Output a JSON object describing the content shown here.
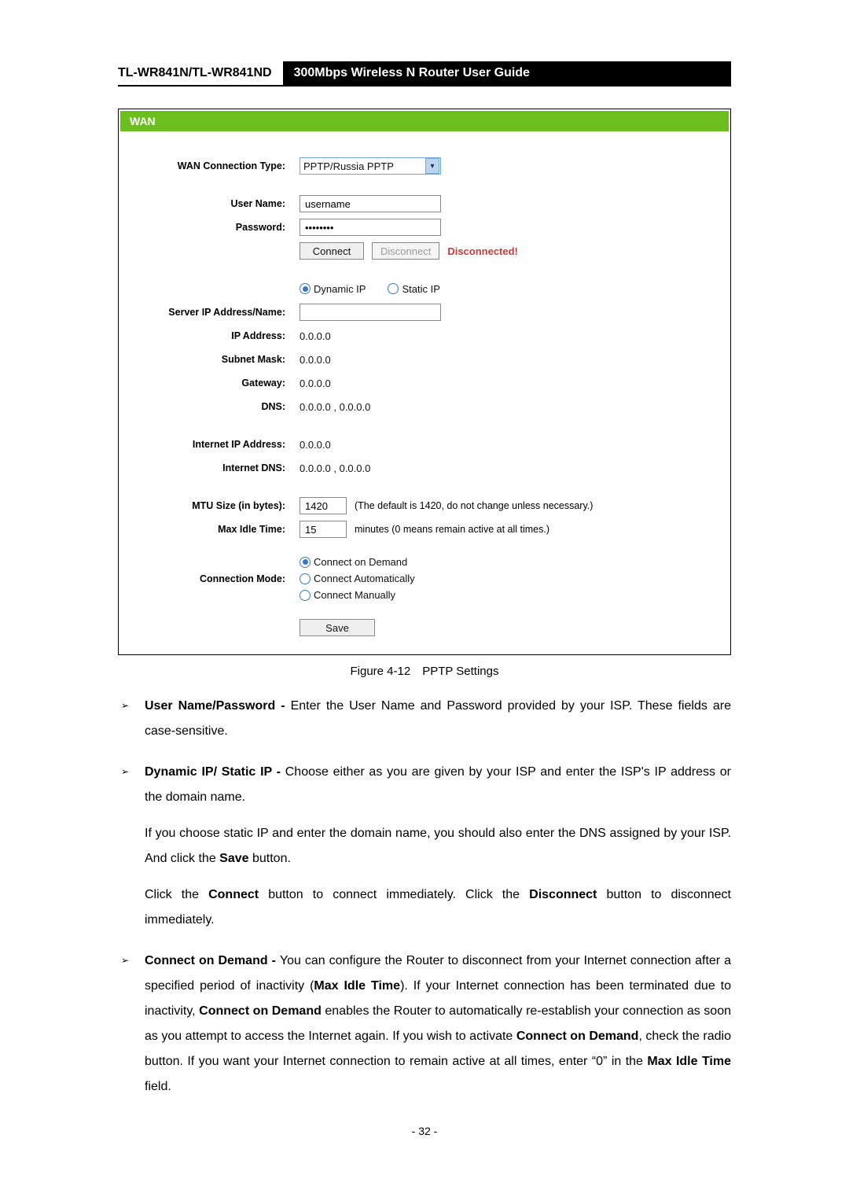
{
  "header": {
    "left": "TL-WR841N/TL-WR841ND",
    "right": "300Mbps Wireless N Router User Guide"
  },
  "panel": {
    "title": "WAN",
    "labels": {
      "wan_conn_type": "WAN Connection Type:",
      "user_name": "User Name:",
      "password": "Password:",
      "server_ip": "Server IP Address/Name:",
      "ip_addr": "IP Address:",
      "subnet": "Subnet Mask:",
      "gateway": "Gateway:",
      "dns": "DNS:",
      "internet_ip": "Internet IP Address:",
      "internet_dns": "Internet DNS:",
      "mtu": "MTU Size (in bytes):",
      "max_idle": "Max Idle Time:",
      "conn_mode": "Connection Mode:"
    },
    "values": {
      "wan_conn_type": "PPTP/Russia PPTP",
      "user_name": "username",
      "password": "••••••••",
      "server_ip": "",
      "ip_addr": "0.0.0.0",
      "subnet": "0.0.0.0",
      "gateway": "0.0.0.0",
      "dns": "0.0.0.0 , 0.0.0.0",
      "internet_ip": "0.0.0.0",
      "internet_dns": "0.0.0.0 , 0.0.0.0",
      "mtu": "1420",
      "max_idle": "15"
    },
    "hints": {
      "mtu": "(The default is 1420, do not change unless necessary.)",
      "max_idle": "minutes (0 means remain active at all times.)"
    },
    "buttons": {
      "connect": "Connect",
      "disconnect": "Disconnect",
      "save": "Save"
    },
    "status": "Disconnected!",
    "ip_mode": {
      "dynamic": "Dynamic IP",
      "static": "Static IP",
      "selected": "dynamic"
    },
    "conn_mode_opts": {
      "on_demand": "Connect on Demand",
      "auto": "Connect Automatically",
      "manual": "Connect Manually",
      "selected": "on_demand"
    }
  },
  "caption": "Figure 4-12 PPTP Settings",
  "bullets": {
    "b1_strong": "User Name/Password - ",
    "b1_rest": "Enter the User Name and Password provided by your ISP. These fields are case-sensitive.",
    "b2_strong": "Dynamic IP/ Static IP - ",
    "b2_rest": "Choose either as you are given by your ISP and enter the ISP's IP address or the domain name.",
    "b2_p1a": "If you choose static IP and enter the domain name, you should also enter the DNS assigned by your ISP. And click the ",
    "b2_p1_save": "Save",
    "b2_p1b": " button.",
    "b2_p2a": "Click the ",
    "b2_p2_connect": "Connect",
    "b2_p2b": " button to connect immediately. Click the ",
    "b2_p2_disconnect": "Disconnect",
    "b2_p2c": " button to disconnect immediately.",
    "b3_strong": "Connect on Demand - ",
    "b3_a": "You can configure the Router to disconnect from your Internet connection after a specified period of inactivity (",
    "b3_mit": "Max Idle Time",
    "b3_b": "). If your Internet connection has been terminated due to inactivity, ",
    "b3_cod": "Connect on Demand",
    "b3_c": " enables the Router to automatically re-establish your connection as soon as you attempt to access the Internet again. If you wish to activate ",
    "b3_cod2": "Connect on Demand",
    "b3_d": ", check the radio button. If you want your Internet connection to remain active at all times, enter “0” in the ",
    "b3_mit2": "Max Idle Time",
    "b3_e": " field."
  },
  "page_number": "- 32 -"
}
